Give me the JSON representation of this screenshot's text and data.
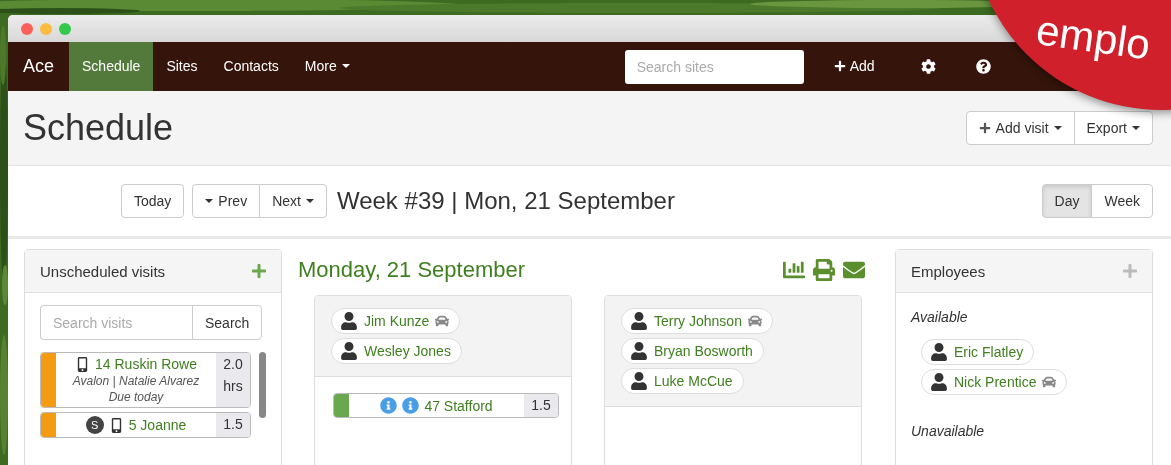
{
  "navbar": {
    "brand": "Ace",
    "items": [
      {
        "label": "Schedule",
        "selected": true,
        "dropdown": false
      },
      {
        "label": "Sites",
        "selected": false,
        "dropdown": false
      },
      {
        "label": "Contacts",
        "selected": false,
        "dropdown": false
      },
      {
        "label": "More",
        "selected": false,
        "dropdown": true
      }
    ],
    "search": {
      "placeholder": "Search sites"
    },
    "add_label": "Add"
  },
  "page": {
    "title": "Schedule",
    "actions": [
      {
        "label": "Add visit",
        "kind": "add"
      },
      {
        "label": "Export",
        "kind": "menu"
      }
    ]
  },
  "toolbar": {
    "today": "Today",
    "prev": "Prev",
    "next": "Next",
    "heading": "Week #39 | Mon, 21 September",
    "views": [
      {
        "label": "Day",
        "selected": true
      },
      {
        "label": "Week",
        "selected": false
      }
    ]
  },
  "unscheduled": {
    "title": "Unscheduled visits",
    "search": {
      "placeholder": "Search visits",
      "button": "Search"
    },
    "visits": [
      {
        "color": "#f39c12",
        "mobile": true,
        "title": "14 Ruskin Rowe",
        "hours": "2.0",
        "unit": "hrs",
        "details": "Avalon | Natalie Alvarez",
        "due": "Due today"
      },
      {
        "color": "#f39c12",
        "badge": "S",
        "mobile": true,
        "title": "5 Joanne",
        "hours": "1.5"
      }
    ]
  },
  "day": {
    "heading": "Monday, 21 September",
    "columns": [
      {
        "employees": [
          {
            "name": "Jim Kunze",
            "car": true
          },
          {
            "name": "Wesley Jones",
            "car": false
          }
        ],
        "visits": [
          {
            "color": "#6aa84f",
            "alerts": [
              {
                "kind": "info"
              },
              {
                "kind": "info"
              }
            ],
            "title": "47 Stafford",
            "hours": "1.5"
          }
        ]
      },
      {
        "employees": [
          {
            "name": "Terry Johnson",
            "car": true
          },
          {
            "name": "Bryan Bosworth",
            "car": false
          },
          {
            "name": "Luke McCue",
            "car": false
          }
        ]
      }
    ]
  },
  "employees": {
    "title": "Employees",
    "groups": [
      {
        "label": "Available",
        "people": [
          {
            "name": "Eric Flatley",
            "car": false
          },
          {
            "name": "Nick Prentice",
            "car": true
          }
        ]
      },
      {
        "label": "Unavailable"
      }
    ]
  },
  "promo": {
    "text": "emplo"
  }
}
